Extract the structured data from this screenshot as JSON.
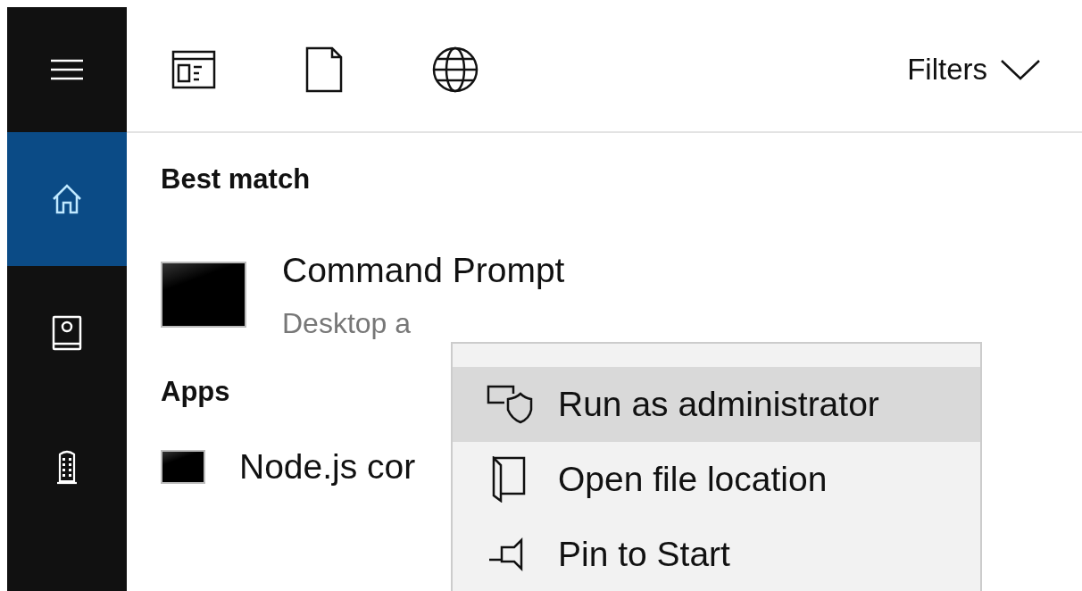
{
  "sidebar": {
    "items": [
      {
        "kind": "menu",
        "selected": false
      },
      {
        "kind": "home",
        "selected": true
      },
      {
        "kind": "notebook",
        "selected": false
      },
      {
        "kind": "tower",
        "selected": false
      }
    ]
  },
  "toolbar": {
    "icons": [
      {
        "kind": "apps"
      },
      {
        "kind": "document"
      },
      {
        "kind": "web"
      }
    ],
    "filters": "Filters"
  },
  "sections": [
    {
      "heading": "Best match",
      "results": [
        {
          "title": "Command Prompt",
          "subtitle": "Desktop a",
          "kind": "large"
        }
      ]
    },
    {
      "heading": "Apps",
      "results": [
        {
          "title": "Node.js cor",
          "kind": "small"
        }
      ]
    }
  ],
  "context_menu": {
    "items": [
      {
        "kind": "shield",
        "label": "Run as administrator",
        "selected": true
      },
      {
        "kind": "folder",
        "label": "Open file location",
        "selected": false
      },
      {
        "kind": "pin",
        "label": "Pin to Start",
        "selected": false
      }
    ]
  }
}
